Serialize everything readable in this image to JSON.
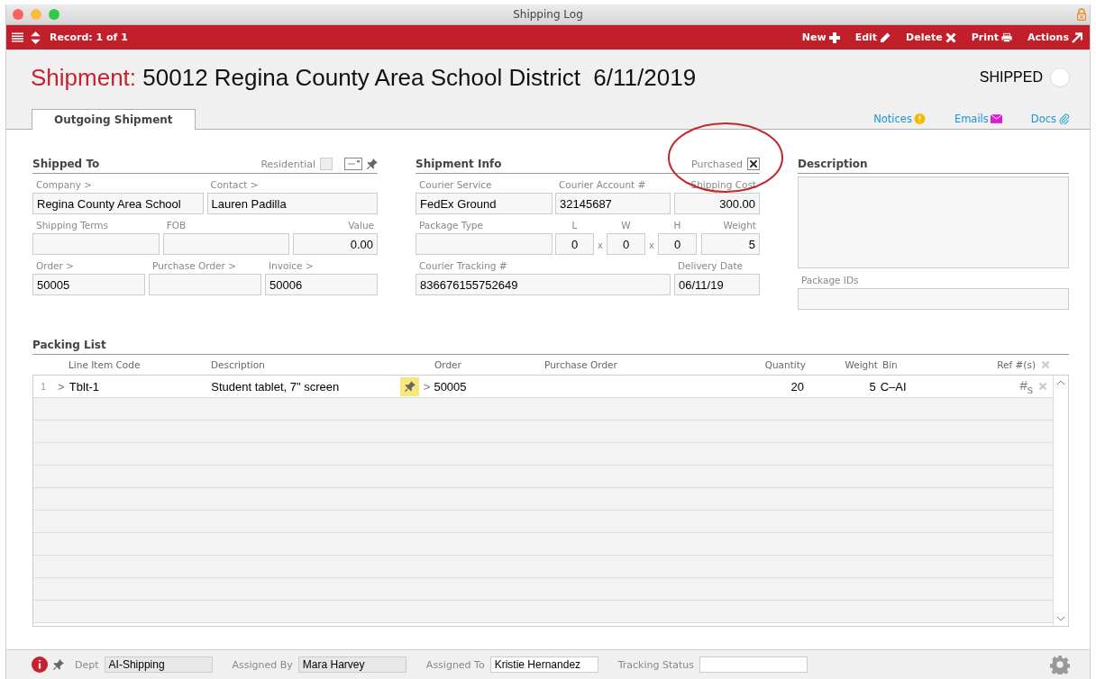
{
  "window": {
    "title": "Shipping Log"
  },
  "toolbar": {
    "record": "Record: 1 of 1",
    "actions": [
      {
        "label": "New"
      },
      {
        "label": "Edit"
      },
      {
        "label": "Delete"
      },
      {
        "label": "Print"
      },
      {
        "label": "Actions"
      }
    ]
  },
  "header": {
    "prefix": "Shipment:",
    "title": "50012 Regina County Area School District",
    "date": "6/11/2019",
    "status": {
      "label": "SHIPPED",
      "checked": false
    }
  },
  "tabs": [
    {
      "label": "Outgoing Shipment",
      "selected": true
    }
  ],
  "links": [
    {
      "label": "Notices"
    },
    {
      "label": "Emails"
    },
    {
      "label": "Docs"
    }
  ],
  "shipped_to": {
    "title": "Shipped To",
    "option": {
      "label": "Residential",
      "checked": false
    },
    "rows": [
      [
        {
          "label": "Company >",
          "value": "Regina County Area School",
          "kind": "text"
        },
        {
          "label": "Contact >",
          "value": "Lauren Padilla",
          "kind": "text"
        }
      ],
      [
        {
          "label": "Shipping Terms",
          "kind": "text"
        },
        {
          "label": "FOB",
          "kind": "text"
        },
        {
          "label": "Value",
          "value": "0.00",
          "kind": "number"
        }
      ],
      [
        {
          "label": "Order >",
          "value": "50005",
          "kind": "text"
        },
        {
          "label": "Purchase Order >",
          "kind": "text"
        },
        {
          "label": "Invoice >",
          "value": "50006",
          "kind": "text"
        }
      ]
    ]
  },
  "shipment_info": {
    "title": "Shipment Info",
    "option": {
      "label": "Purchased",
      "checked": true
    },
    "fields": [
      {
        "label": "Courier Service",
        "value": "FedEx Ground",
        "kind": "text"
      },
      {
        "label": "Courier Account #",
        "value": "32145687",
        "kind": "text"
      },
      {
        "label": "Shipping Cost",
        "value": "300.00",
        "kind": "number"
      },
      {
        "label": "Package Type",
        "kind": "text"
      },
      {
        "label": "L",
        "value": "0",
        "kind": "dim"
      },
      {
        "label": "x",
        "kind": "sep"
      },
      {
        "label": "W",
        "value": "0",
        "kind": "dim"
      },
      {
        "label": "x",
        "kind": "sep"
      },
      {
        "label": "H",
        "value": "0",
        "kind": "dim"
      },
      {
        "label": "Weight",
        "value": "5",
        "kind": "number"
      },
      {
        "label": "Courier Tracking #",
        "value": "836676155752649",
        "kind": "text"
      },
      {
        "label": "Delivery Date",
        "value": "06/11/19",
        "kind": "text"
      }
    ]
  },
  "description": {
    "title": "Description",
    "package_ids_label": "Package IDs"
  },
  "packing_list": {
    "title": "Packing List",
    "columns": [
      "Line Item Code",
      "Description",
      "Order",
      "Purchase Order",
      "Quantity",
      "Weight",
      "Bin",
      "Ref #(s)"
    ],
    "rows": [
      {
        "index": "1",
        "code_chevron": ">",
        "code": "Tblt-1",
        "description": "Student tablet, 7\" screen",
        "order_chevron": ">",
        "order": "50005",
        "quantity": "20",
        "weight": "5",
        "bin": "C–AI",
        "ref": "#$_{s}$"
      }
    ]
  },
  "footer": {
    "fields": [
      {
        "label": "Dept",
        "value": "AI-Shipping",
        "editable": false
      },
      {
        "label": "Assigned By",
        "value": "Mara Harvey",
        "editable": false
      },
      {
        "label": "Assigned To",
        "value": "Kristie Hernandez",
        "editable": true
      },
      {
        "label": "Tracking Status",
        "editable": true
      }
    ]
  }
}
